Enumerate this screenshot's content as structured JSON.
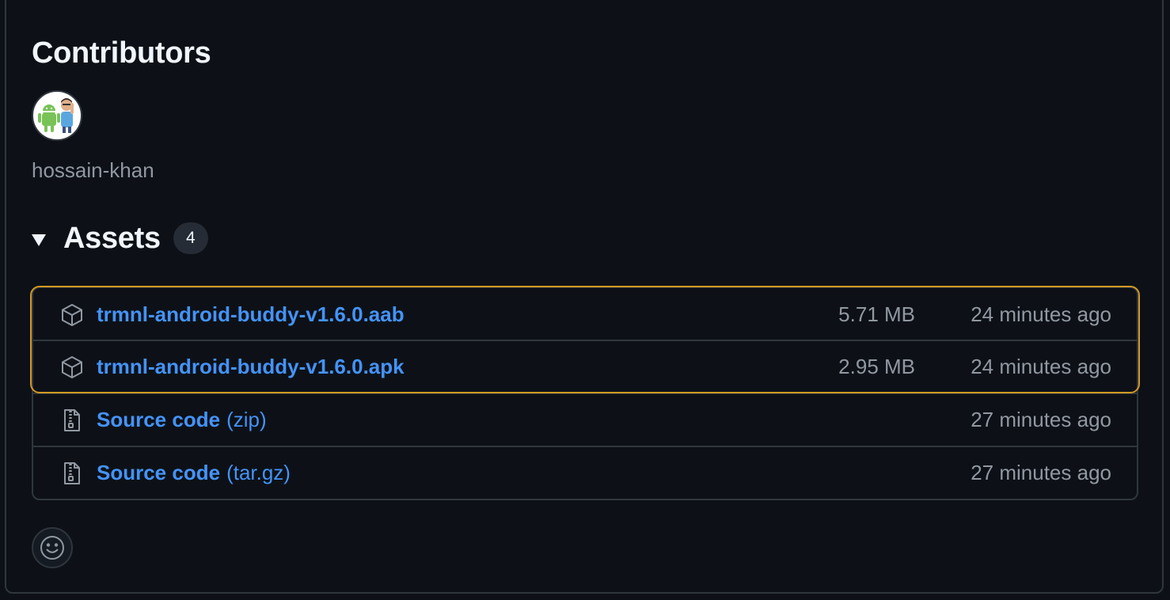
{
  "contributors": {
    "title": "Contributors",
    "users": [
      {
        "name": "hossain-khan",
        "avatar_icon": "android-robot-avatar-icon"
      }
    ]
  },
  "assets": {
    "title": "Assets",
    "count": "4",
    "items": [
      {
        "icon": "package-icon",
        "name": "trmnl-android-buddy-v1.6.0.aab",
        "suffix": "",
        "size": "5.71 MB",
        "time": "24 minutes ago",
        "highlighted": true
      },
      {
        "icon": "package-icon",
        "name": "trmnl-android-buddy-v1.6.0.apk",
        "suffix": "",
        "size": "2.95 MB",
        "time": "24 minutes ago",
        "highlighted": true
      },
      {
        "icon": "file-zip-icon",
        "name": "Source code",
        "suffix": "(zip)",
        "size": "",
        "time": "27 minutes ago",
        "highlighted": false
      },
      {
        "icon": "file-zip-icon",
        "name": "Source code",
        "suffix": "(tar.gz)",
        "size": "",
        "time": "27 minutes ago",
        "highlighted": false
      }
    ]
  },
  "colors": {
    "background": "#0d1117",
    "border": "#30363d",
    "link": "#4493f8",
    "muted": "#9198a1",
    "highlight": "#d29922"
  },
  "reaction": {
    "icon": "smiley-icon"
  }
}
